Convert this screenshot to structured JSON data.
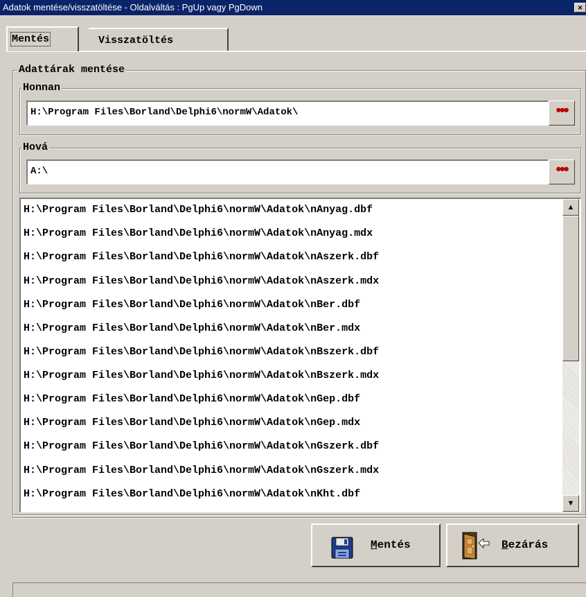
{
  "window": {
    "title": "Adatok mentése/visszatöltése - Oldalváltás : PgUp vagy PgDown",
    "close_glyph": "×"
  },
  "tabs": [
    {
      "label": "Mentés",
      "active": true
    },
    {
      "label": "Visszatöltés",
      "active": false
    }
  ],
  "backup_group": {
    "legend": "Adattárak mentése",
    "from": {
      "legend": "Honnan",
      "value": "H:\\Program Files\\Borland\\Delphi6\\normW\\Adatok\\",
      "browse_label": "•••"
    },
    "to": {
      "legend": "Hová",
      "value": "A:\\",
      "browse_label": "•••"
    }
  },
  "file_list": [
    "H:\\Program Files\\Borland\\Delphi6\\normW\\Adatok\\nAnyag.dbf",
    "H:\\Program Files\\Borland\\Delphi6\\normW\\Adatok\\nAnyag.mdx",
    "H:\\Program Files\\Borland\\Delphi6\\normW\\Adatok\\nAszerk.dbf",
    "H:\\Program Files\\Borland\\Delphi6\\normW\\Adatok\\nAszerk.mdx",
    "H:\\Program Files\\Borland\\Delphi6\\normW\\Adatok\\nBer.dbf",
    "H:\\Program Files\\Borland\\Delphi6\\normW\\Adatok\\nBer.mdx",
    "H:\\Program Files\\Borland\\Delphi6\\normW\\Adatok\\nBszerk.dbf",
    "H:\\Program Files\\Borland\\Delphi6\\normW\\Adatok\\nBszerk.mdx",
    "H:\\Program Files\\Borland\\Delphi6\\normW\\Adatok\\nGep.dbf",
    "H:\\Program Files\\Borland\\Delphi6\\normW\\Adatok\\nGep.mdx",
    "H:\\Program Files\\Borland\\Delphi6\\normW\\Adatok\\nGszerk.dbf",
    "H:\\Program Files\\Borland\\Delphi6\\normW\\Adatok\\nGszerk.mdx",
    "H:\\Program Files\\Borland\\Delphi6\\normW\\Adatok\\nKht.dbf"
  ],
  "scrollbar": {
    "up_glyph": "▲",
    "down_glyph": "▼"
  },
  "buttons": {
    "save": {
      "accel": "M",
      "rest": "entés",
      "icon": "floppy-disk-icon"
    },
    "close": {
      "accel": "B",
      "rest": "ezárás",
      "icon": "exit-door-icon"
    }
  },
  "colors": {
    "titlebar": "#0a246a",
    "face": "#d4d0c8",
    "browse_dots": "#c00000"
  }
}
